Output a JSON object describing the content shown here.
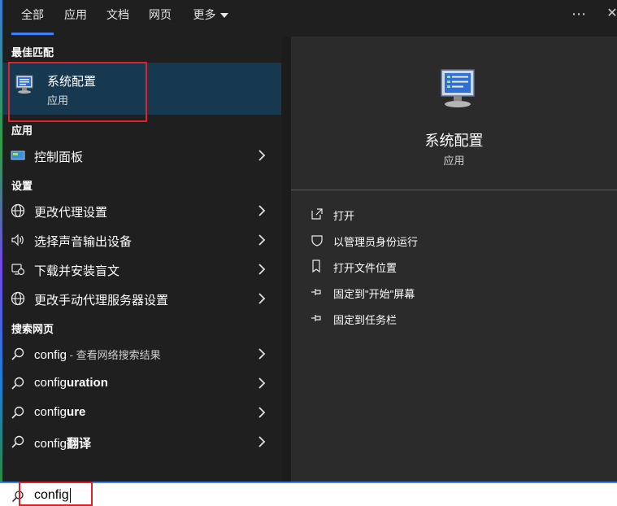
{
  "tabs": [
    {
      "label": "全部",
      "active": true
    },
    {
      "label": "应用"
    },
    {
      "label": "文档"
    },
    {
      "label": "网页"
    },
    {
      "label": "更多"
    }
  ],
  "top_icons": {
    "more": "⋯",
    "close": "✕"
  },
  "left": {
    "best_match_label": "最佳匹配",
    "best_match": {
      "title": "系统配置",
      "subtitle": "应用",
      "icon": "msconfig-icon"
    },
    "apps_label": "应用",
    "apps": [
      {
        "label": "控制面板",
        "icon": "control-panel-icon"
      }
    ],
    "settings_label": "设置",
    "settings": [
      {
        "label": "更改代理设置",
        "icon": "globe-icon"
      },
      {
        "label": "选择声音输出设备",
        "icon": "speaker-icon"
      },
      {
        "label": "下载并安装盲文",
        "icon": "accessibility-icon"
      },
      {
        "label": "更改手动代理服务器设置",
        "icon": "globe-icon"
      }
    ],
    "web_label": "搜索网页",
    "web": [
      {
        "prefix": "config",
        "bold": "",
        "suffix": " - 查看网络搜索结果"
      },
      {
        "prefix": "config",
        "bold": "uration",
        "suffix": ""
      },
      {
        "prefix": "config",
        "bold": "ure",
        "suffix": ""
      },
      {
        "prefix": "config",
        "bold": "翻译",
        "suffix": ""
      }
    ]
  },
  "right": {
    "title": "系统配置",
    "subtitle": "应用",
    "actions": [
      {
        "label": "打开",
        "icon": "open-icon"
      },
      {
        "label": "以管理员身份运行",
        "icon": "shield-icon"
      },
      {
        "label": "打开文件位置",
        "icon": "folder-location-icon"
      },
      {
        "label": "固定到\"开始\"屏幕",
        "icon": "pin-icon"
      },
      {
        "label": "固定到任务栏",
        "icon": "pin-icon"
      }
    ]
  },
  "search": {
    "value": "config"
  },
  "colors": {
    "accent": "#3b82f6",
    "highlight": "#e0202a",
    "selected_bg": "#17394f"
  }
}
